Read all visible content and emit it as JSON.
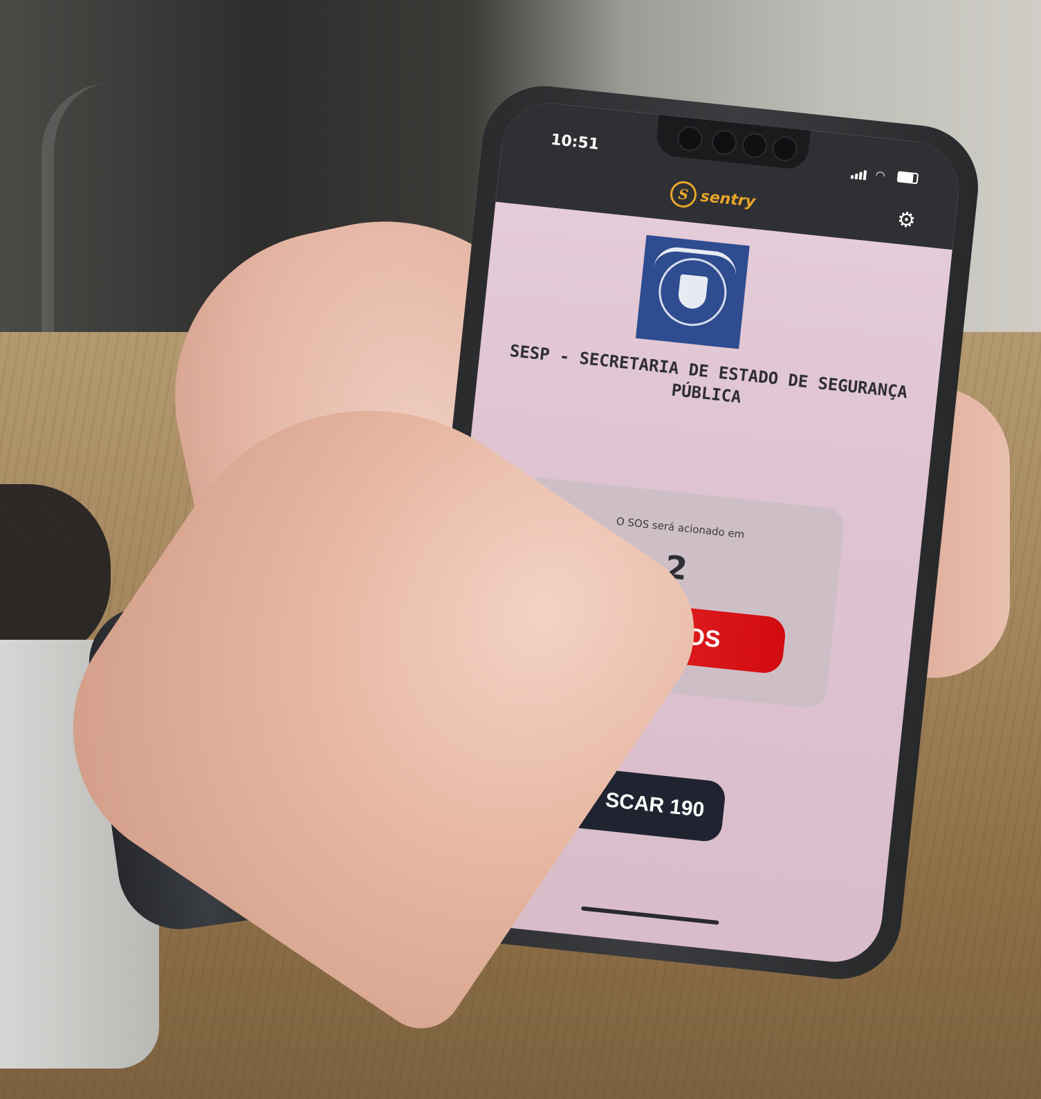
{
  "status_bar": {
    "time": "10:51"
  },
  "app": {
    "brand_name": "sentry",
    "brand_initial": "S",
    "settings_icon": "gear-icon"
  },
  "org": {
    "name": "SESP - SECRETARIA DE ESTADO DE SEGURANÇA PÚBLICA"
  },
  "sos": {
    "caption": "O SOS será acionado em",
    "countdown": "2",
    "cancel_label": "Cancelar SOS"
  },
  "call": {
    "label": "SCAR 190"
  },
  "colors": {
    "accent_gold": "#e8a62a",
    "cancel_red": "#dd1c1f",
    "call_dark": "#1f2430",
    "crest_blue": "#2e4c8f"
  }
}
